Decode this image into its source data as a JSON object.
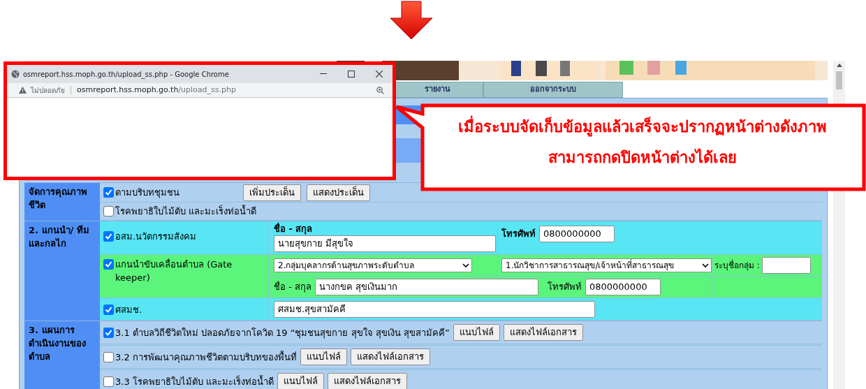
{
  "popup": {
    "title": "osmreport.hss.moph.go.th/upload_ss.php - Google Chrome",
    "security_label": "ไม่ปลอดภัย",
    "url_host": "osmreport.hss.moph.go.th",
    "url_path": "/upload_ss.php"
  },
  "callout": {
    "lines": [
      "เมื่อระบบจัดเก็บข้อมูลแล้วเสร็จจะปรากฏหน้าต่างดังภาพ",
      "สามารถกดปิดหน้าต่างได้เลย"
    ]
  },
  "nav_tabs": [
    {
      "label": "รายงาน"
    },
    {
      "label": "ออกจากระบบ"
    }
  ],
  "sections": [
    {
      "kind": "issues",
      "label": "จัดการคุณภาพ ชีวิต",
      "rows": [
        {
          "label": "ตามบริบทชุมชน",
          "checked": true,
          "buttons": [
            "เพิ่มประเด็น",
            "แสดงประเด็น"
          ]
        },
        {
          "label": "โรคพยาธิใบไม้ตับ และมะเร็งท่อน้ำดี",
          "checked": false
        }
      ]
    },
    {
      "kind": "team",
      "label": "2. แกนนำ/ ทีม และกลไก",
      "rows": [
        {
          "kind": "person",
          "label": "อสม.นวัตกรรมสังคม",
          "checked": true,
          "name_header": "ชื่อ - สกุล",
          "name_value": "นายสุขกาย มีสุขใจ",
          "phone_label": "โทรศัพท์",
          "phone_value": "0800000000"
        },
        {
          "kind": "gatekeeper",
          "label": "แกนนำขับเคลื่อนตำบล (Gate keeper)",
          "checked": true,
          "select_1": "2.กลุ่มบุคลากรด้านสุขภาพระดับตำบล",
          "select_2": "1.นักวิชาการสาธารณสุข/เจ้าหน้าที่สาธารณสุข",
          "group_label": "ระบุชื่อกลุ่ม :",
          "name_label": "ชื่อ - สกุล",
          "name_value": "นางกขค สุขเงินมาก",
          "phone_label": "โทรศัพท์",
          "phone_value": "0800000000"
        },
        {
          "kind": "org",
          "label": "ศสมช.",
          "checked": true,
          "value": "ศสมช.สุขสามัคคี"
        }
      ]
    },
    {
      "kind": "plans",
      "label": "3. แผนการ ดำเนินงานของ ตำบล",
      "rows": [
        {
          "label": "3.1 ตำบลวิถีชีวิตใหม่ ปลอดภัยจากโควิด 19 “ชุมชนสุขกาย สุขใจ สุขเงิน สุขสามัคคี”",
          "checked": true,
          "buttons": [
            "แนบไฟล์",
            "แสดงไฟล์เอกสาร"
          ]
        },
        {
          "label": "3.2 การพัฒนาคุณภาพชีวิตตามบริบทของพื้นที่",
          "checked": false,
          "buttons": [
            "แนบไฟล์",
            "แสดงไฟล์เอกสาร"
          ]
        },
        {
          "label": "3.3 โรคพยาธิใบไม้ตับ และมะเร็งท่อน้ำดี",
          "checked": false,
          "buttons": [
            "แนบไฟล์",
            "แสดงไฟล์เอกสาร"
          ]
        }
      ]
    }
  ]
}
